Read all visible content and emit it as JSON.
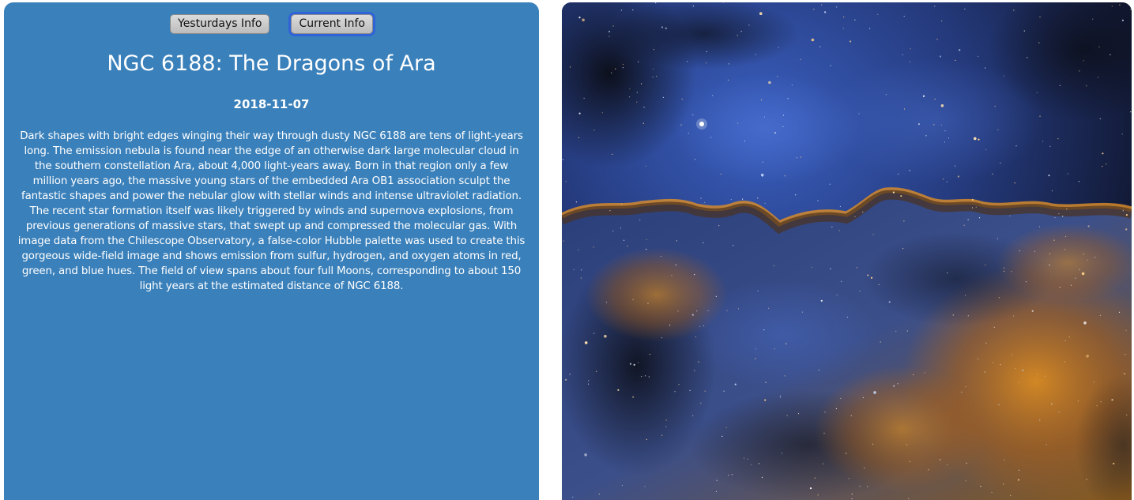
{
  "buttons": {
    "yesterday_label": "Yesturdays Info",
    "current_label": "Current Info"
  },
  "apod": {
    "title": "NGC 6188: The Dragons of Ara",
    "date": "2018-11-07",
    "explanation": "Dark shapes with bright edges winging their way through dusty NGC 6188 are tens of light-years long. The emission nebula is found near the edge of an otherwise dark large molecular cloud in the southern constellation Ara, about 4,000 light-years away. Born in that region only a few million years ago, the massive young stars of the embedded Ara OB1 association sculpt the fantastic shapes and power the nebular glow with stellar winds and intense ultraviolet radiation. The recent star formation itself was likely triggered by winds and supernova explosions, from previous generations of massive stars, that swept up and compressed the molecular gas. With image data from the Chilescope Observatory, a false-color Hubble palette was used to create this gorgeous wide-field image and shows emission from sulfur, hydrogen, and oxygen atoms in red, green, and blue hues. The field of view spans about four full Moons, corresponding to about 150 light years at the estimated distance of NGC 6188."
  },
  "colors": {
    "panel_bg": "#3a80ba",
    "focus_ring": "#2f63d8",
    "nebula_blue": "#2f4f9e",
    "nebula_gold": "#c8781a"
  }
}
